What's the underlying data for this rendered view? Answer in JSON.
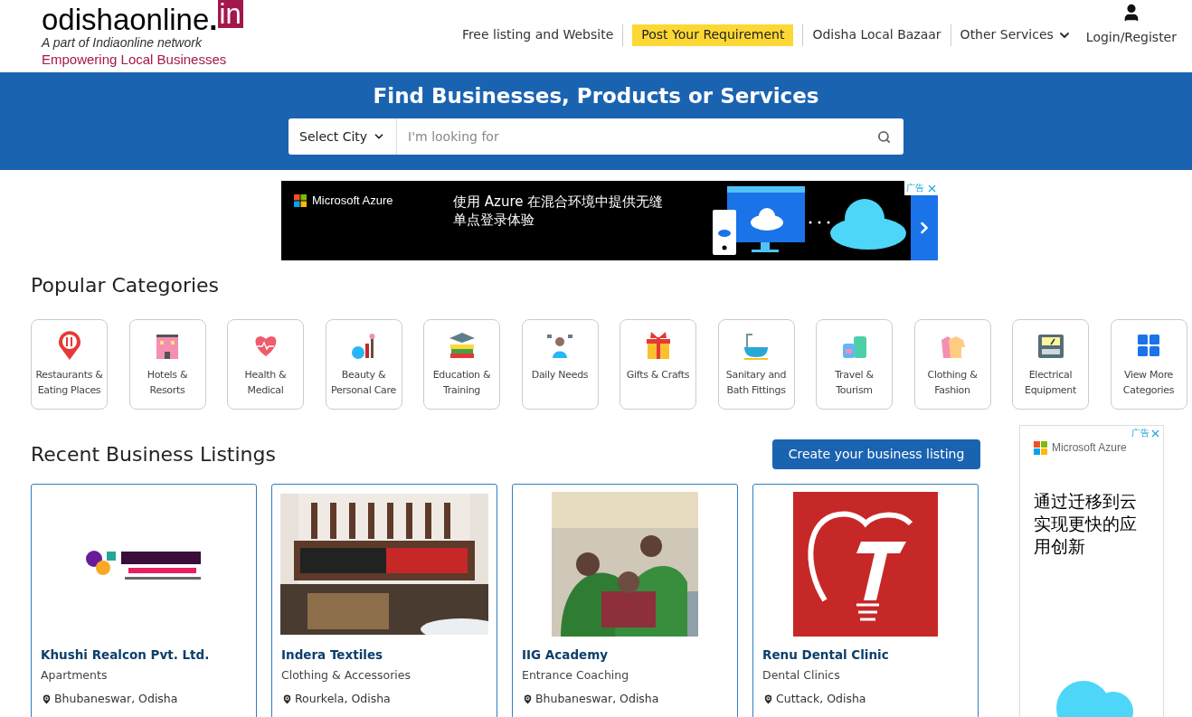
{
  "header": {
    "logo_main": "odishaonline",
    "logo_dot": ".",
    "logo_suffix": "in",
    "tagline": "A part of Indiaonline network",
    "slogan": "Empowering Local Businesses",
    "nav": [
      {
        "label": "Free listing and Website",
        "kind": "link"
      },
      {
        "label": "Post Your Requirement",
        "kind": "highlight"
      },
      {
        "label": "Odisha Local Bazaar",
        "kind": "link"
      },
      {
        "label": "Other Services",
        "kind": "dropdown"
      }
    ],
    "login": "Login/Register"
  },
  "search": {
    "title": "Find Businesses, Products or Services",
    "city": "Select City",
    "placeholder": "I'm looking for"
  },
  "top_ad": {
    "badge": "广告",
    "brand": "Microsoft Azure",
    "text": "使用 Azure 在混合环境中提供无缝单点登录体验"
  },
  "categories_title": "Popular Categories",
  "categories": [
    {
      "label": "Restaurants & Eating Places"
    },
    {
      "label": "Hotels & Resorts"
    },
    {
      "label": "Health & Medical"
    },
    {
      "label": "Beauty & Personal Care"
    },
    {
      "label": "Education & Training"
    },
    {
      "label": "Daily Needs"
    },
    {
      "label": "Gifts & Crafts"
    },
    {
      "label": "Sanitary and Bath Fittings"
    },
    {
      "label": "Travel & Tourism"
    },
    {
      "label": "Clothing & Fashion"
    },
    {
      "label": "Electrical Equipment"
    },
    {
      "label": "View More Categories"
    }
  ],
  "listings_title": "Recent Business Listings",
  "create_button": "Create your business listing",
  "listings": [
    {
      "name": "Khushi Realcon Pvt. Ltd.",
      "category": "Apartments",
      "location": "Bhubaneswar, Odisha"
    },
    {
      "name": "Indera Textiles",
      "category": "Clothing & Accessories",
      "location": "Rourkela, Odisha"
    },
    {
      "name": "IIG Academy",
      "category": "Entrance Coaching",
      "location": "Bhubaneswar, Odisha"
    },
    {
      "name": "Renu Dental Clinic",
      "category": "Dental Clinics",
      "location": "Cuttack, Odisha"
    }
  ],
  "side_ad": {
    "badge": "广告",
    "brand": "Microsoft Azure",
    "text": "通过迁移到云实现更快的应用创新"
  }
}
